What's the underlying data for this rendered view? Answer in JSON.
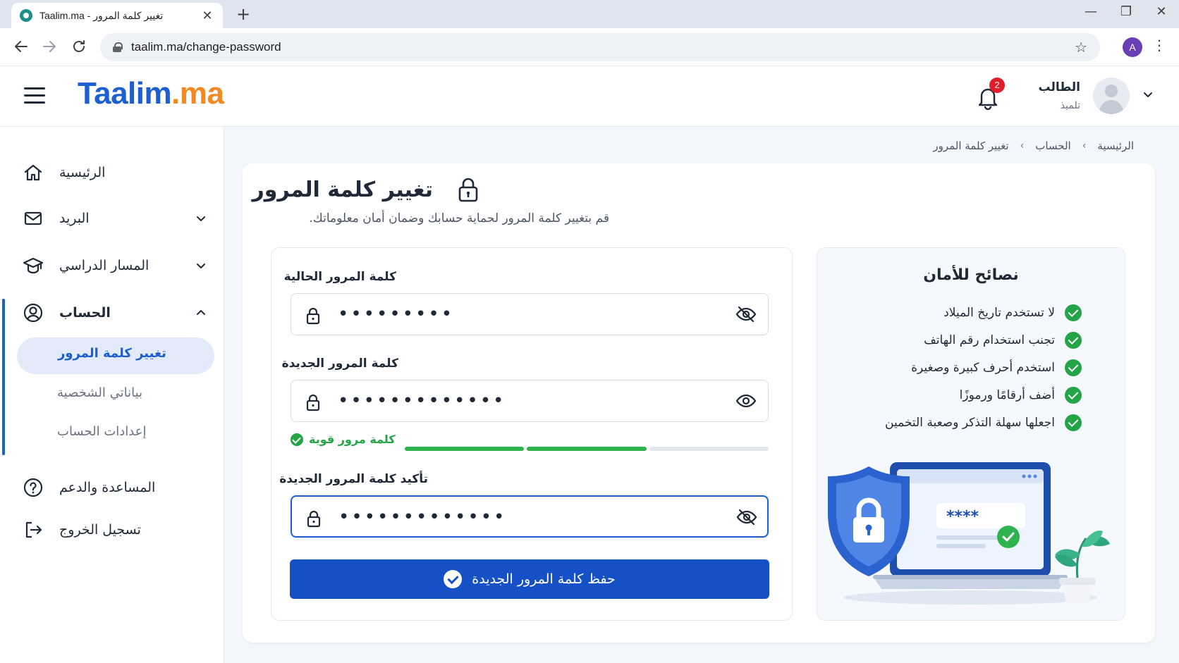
{
  "browser": {
    "tab_title": "Taalim.ma - تغيير كلمة المرور",
    "url": "taalim.ma/change-password",
    "profile_initial": "A",
    "new_tab": "+",
    "close": "✕",
    "minimize": "—",
    "restore": "❐",
    "window_close": "✕"
  },
  "header": {
    "logo_part1": "Taalim",
    "logo_part2": ".ma",
    "notifications_count": "2",
    "user_name": "الطالب",
    "user_role": "تلميذ"
  },
  "sidebar": {
    "items": [
      {
        "label": "الرئيسية",
        "icon": "home-icon"
      },
      {
        "label": "البريد",
        "icon": "mail-icon"
      },
      {
        "label": "المسار الدراسي",
        "icon": "graduation-cap-icon"
      },
      {
        "label": "الحساب",
        "icon": "user-icon"
      },
      {
        "label": "المساعدة والدعم",
        "icon": "help-icon"
      },
      {
        "label": "تسجيل الخروج",
        "icon": "logout-icon"
      }
    ],
    "sub_items": [
      {
        "label": "تغيير كلمة المرور",
        "active": true
      },
      {
        "label": "بياناتي الشخصية",
        "active": false
      },
      {
        "label": "إعدادات الحساب",
        "active": false
      }
    ]
  },
  "breadcrumb": {
    "items": [
      "الرئيسية",
      "الحساب",
      "تغيير كلمة المرور"
    ],
    "separator": "‹"
  },
  "page": {
    "title": "تغيير كلمة المرور",
    "subtitle": "قم بتغيير كلمة المرور لحماية حسابك وضمان أمان معلوماتك."
  },
  "form": {
    "current_label": "كلمة المرور الحالية",
    "current_value": "•••••••••",
    "new_label": "كلمة المرور الجديدة",
    "new_value": "•••••••••••••",
    "strength_text": "كلمة مرور قوية",
    "strength_level": 0.67,
    "confirm_label": "تأكيد كلمة المرور الجديدة",
    "confirm_value": "•••••••••••••",
    "submit_label": "حفظ كلمة المرور الجديدة"
  },
  "tips": {
    "title": "نصائح للأمان",
    "items": [
      "لا تستخدم تاريخ الميلاد",
      "تجنب استخدام رقم الهاتف",
      "استخدم أحرف كبيرة وصغيرة",
      "أضف أرقامًا ورموزًا",
      "اجعلها سهلة التذكر وصعبة التخمين"
    ],
    "illustration_password": "****"
  },
  "colors": {
    "primary": "#1d5fd1",
    "button": "#1550c7",
    "accent": "#f18a22",
    "success": "#22a447",
    "danger": "#e11d2a"
  }
}
